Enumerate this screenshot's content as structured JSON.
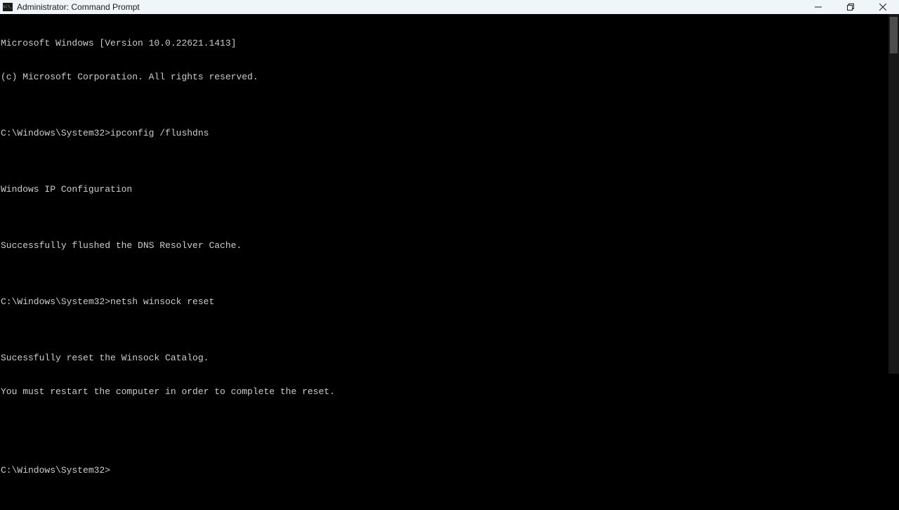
{
  "window": {
    "title": "Administrator: Command Prompt"
  },
  "terminal": {
    "lines": [
      "Microsoft Windows [Version 10.0.22621.1413]",
      "(c) Microsoft Corporation. All rights reserved.",
      "",
      "C:\\Windows\\System32>ipconfig /flushdns",
      "",
      "Windows IP Configuration",
      "",
      "Successfully flushed the DNS Resolver Cache.",
      "",
      "C:\\Windows\\System32>netsh winsock reset",
      "",
      "Sucessfully reset the Winsock Catalog.",
      "You must restart the computer in order to complete the reset.",
      "",
      "",
      "C:\\Windows\\System32>"
    ]
  }
}
